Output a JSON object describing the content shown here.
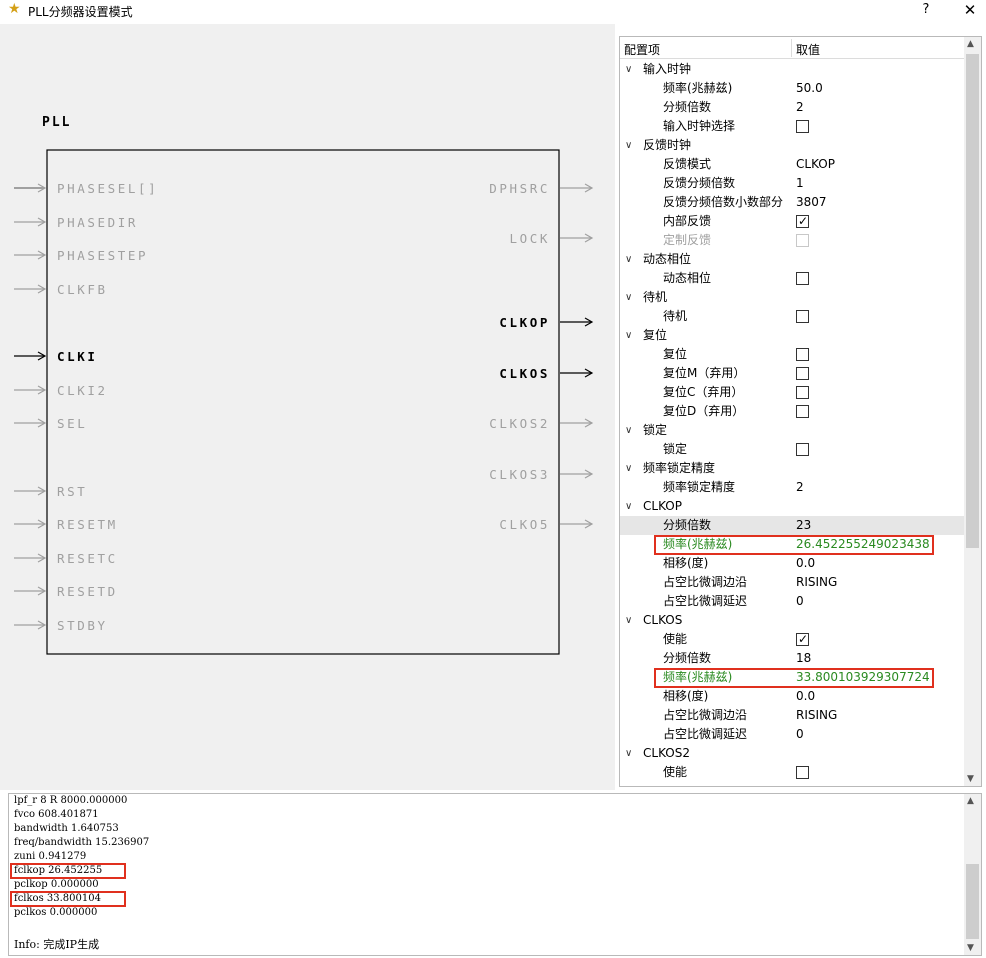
{
  "window": {
    "title": "PLL分频器设置模式",
    "help": "?",
    "close": "✕"
  },
  "schematic": {
    "block_label": "PLL",
    "inputs": [
      {
        "label": "PHASESEL[]",
        "active": false,
        "bus": true
      },
      {
        "label": "PHASEDIR",
        "active": false
      },
      {
        "label": "PHASESTEP",
        "active": false
      },
      {
        "label": "CLKFB",
        "active": false
      },
      {
        "label": "CLKI",
        "active": true
      },
      {
        "label": "CLKI2",
        "active": false
      },
      {
        "label": "SEL",
        "active": false
      },
      {
        "label": "RST",
        "active": false
      },
      {
        "label": "RESETM",
        "active": false
      },
      {
        "label": "RESETC",
        "active": false
      },
      {
        "label": "RESETD",
        "active": false
      },
      {
        "label": "STDBY",
        "active": false
      }
    ],
    "outputs": [
      {
        "label": "DPHSRC",
        "active": false
      },
      {
        "label": "LOCK",
        "active": false
      },
      {
        "label": "CLKOP",
        "active": true
      },
      {
        "label": "CLKOS",
        "active": true
      },
      {
        "label": "CLKOS2",
        "active": false
      },
      {
        "label": "CLKOS3",
        "active": false
      },
      {
        "label": "CLKO5",
        "active": false
      }
    ]
  },
  "tree": {
    "header": {
      "col1": "配置项",
      "col2": "取值"
    },
    "rows": [
      {
        "type": "group",
        "label": "输入时钟"
      },
      {
        "type": "item",
        "label": "频率(兆赫兹)",
        "value": "50.0"
      },
      {
        "type": "item",
        "label": "分频倍数",
        "value": "2"
      },
      {
        "type": "check",
        "label": "输入时钟选择",
        "checked": false
      },
      {
        "type": "group",
        "label": "反馈时钟"
      },
      {
        "type": "item",
        "label": "反馈模式",
        "value": "CLKOP"
      },
      {
        "type": "item",
        "label": "反馈分频倍数",
        "value": "1"
      },
      {
        "type": "item",
        "label": "反馈分频倍数小数部分",
        "value": "3807"
      },
      {
        "type": "check",
        "label": "内部反馈",
        "checked": true
      },
      {
        "type": "check",
        "label": "定制反馈",
        "checked": false,
        "disabled": true
      },
      {
        "type": "group",
        "label": "动态相位"
      },
      {
        "type": "check",
        "label": "动态相位",
        "checked": false
      },
      {
        "type": "group",
        "label": "待机"
      },
      {
        "type": "check",
        "label": "待机",
        "checked": false
      },
      {
        "type": "group",
        "label": "复位"
      },
      {
        "type": "check",
        "label": "复位",
        "checked": false
      },
      {
        "type": "check",
        "label": "复位M（弃用）",
        "checked": false
      },
      {
        "type": "check",
        "label": "复位C（弃用）",
        "checked": false
      },
      {
        "type": "check",
        "label": "复位D（弃用）",
        "checked": false
      },
      {
        "type": "group",
        "label": "锁定"
      },
      {
        "type": "check",
        "label": "锁定",
        "checked": false
      },
      {
        "type": "group",
        "label": "频率锁定精度"
      },
      {
        "type": "item",
        "label": "频率锁定精度",
        "value": "2"
      },
      {
        "type": "group",
        "label": "CLKOP"
      },
      {
        "type": "item",
        "label": "分频倍数",
        "value": "23",
        "selected": true
      },
      {
        "type": "item",
        "label": "频率(兆赫兹)",
        "value": "26.452255249023438",
        "green": true,
        "highlight": true
      },
      {
        "type": "item",
        "label": "相移(度)",
        "value": "0.0"
      },
      {
        "type": "item",
        "label": "占空比微调边沿",
        "value": "RISING"
      },
      {
        "type": "item",
        "label": "占空比微调延迟",
        "value": "0"
      },
      {
        "type": "group",
        "label": "CLKOS"
      },
      {
        "type": "check",
        "label": "使能",
        "checked": true
      },
      {
        "type": "item",
        "label": "分频倍数",
        "value": "18"
      },
      {
        "type": "item",
        "label": "频率(兆赫兹)",
        "value": "33.800103929307724",
        "green": true,
        "highlight": true
      },
      {
        "type": "item",
        "label": "相移(度)",
        "value": "0.0"
      },
      {
        "type": "item",
        "label": "占空比微调边沿",
        "value": "RISING"
      },
      {
        "type": "item",
        "label": "占空比微调延迟",
        "value": "0"
      },
      {
        "type": "group",
        "label": "CLKOS2"
      },
      {
        "type": "check",
        "label": "使能",
        "checked": false
      }
    ]
  },
  "log": {
    "lines": [
      {
        "text": "lpf_r 8 R 8000.000000"
      },
      {
        "text": "fvco 608.401871"
      },
      {
        "text": "bandwidth 1.640753"
      },
      {
        "text": "freq/bandwidth 15.236907"
      },
      {
        "text": "zuni 0.941279"
      },
      {
        "text": "fclkop 26.452255",
        "highlight": true
      },
      {
        "text": "pclkop 0.000000"
      },
      {
        "text": "fclkos 33.800104",
        "highlight": true
      },
      {
        "text": "pclkos 0.000000"
      },
      {
        "text": ""
      },
      {
        "text": "Info: 完成IP生成"
      }
    ]
  },
  "colors": {
    "highlight_border": "#e0301e",
    "green_value": "#2a8a20",
    "pin_inactive": "#a0a0a0",
    "pin_active": "#000000"
  }
}
